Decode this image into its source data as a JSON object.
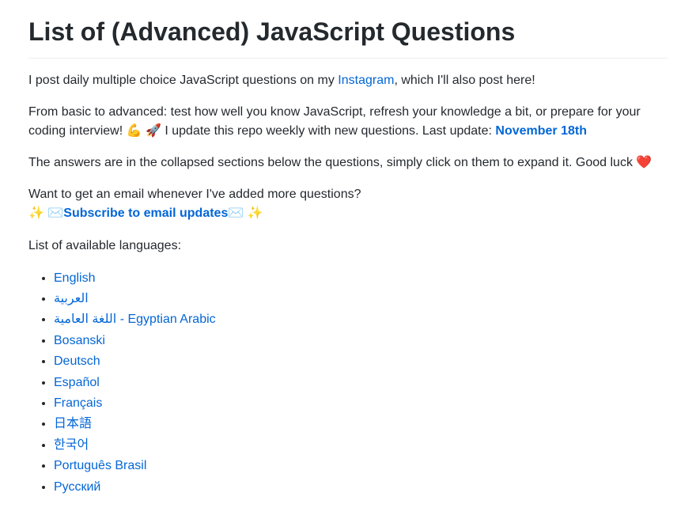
{
  "title": "List of (Advanced) JavaScript Questions",
  "intro": {
    "before": "I post daily multiple choice JavaScript questions on my ",
    "instagram": "Instagram",
    "after": ", which I'll also post here!"
  },
  "para2": {
    "before": "From basic to advanced: test how well you know JavaScript, refresh your knowledge a bit, or prepare for your coding interview! ",
    "mid": " I update this repo weekly with new questions. Last update: ",
    "date": "November 18th"
  },
  "para3": "The answers are in the collapsed sections below the questions, simply click on them to expand it. Good luck ",
  "emailPrompt": "Want to get an email whenever I've added more questions?",
  "subscribe": "Subscribe to email updates",
  "langHeader": "List of available languages:",
  "langs": {
    "l0": "English",
    "l1": "العربية",
    "l2": "اللغة العامية - Egyptian Arabic",
    "l3": "Bosanski",
    "l4": "Deutsch",
    "l5": "Español",
    "l6": "Français",
    "l7": "日本語",
    "l8": "한국어",
    "l9": "Português Brasil",
    "l10": "Русский"
  },
  "emoji": {
    "arm": "💪",
    "rocket": "🚀",
    "heart": "❤️",
    "sparkle": "✨",
    "envelope": "✉️"
  }
}
